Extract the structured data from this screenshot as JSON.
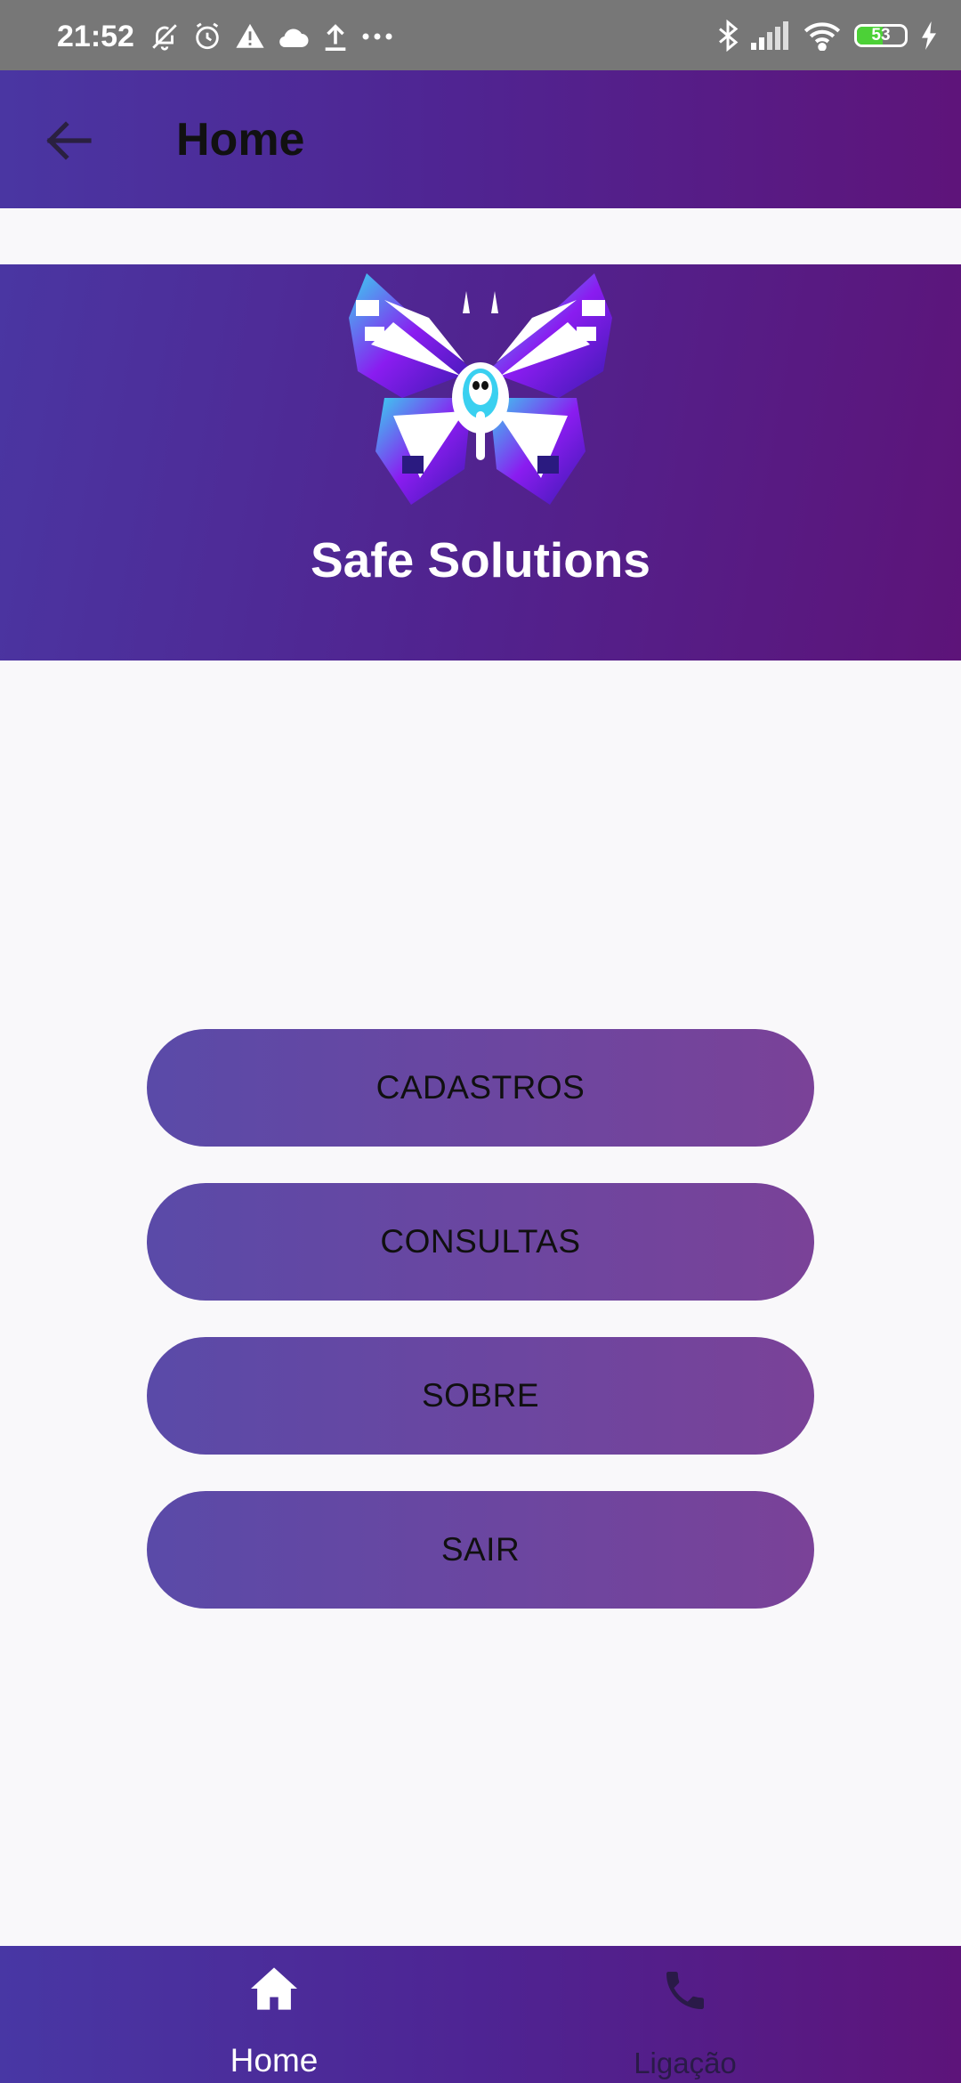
{
  "status_bar": {
    "time": "21:52",
    "battery": "53",
    "battery_level": 0.53,
    "icons_left": [
      "bell-off-icon",
      "alarm-icon",
      "warning-icon",
      "cloud-icon",
      "upload-icon",
      "more-dots-icon"
    ],
    "icons_right": [
      "bluetooth-icon",
      "signal-icon",
      "wifi-icon",
      "battery-icon",
      "charging-icon"
    ]
  },
  "app_bar": {
    "title": "Home",
    "back_icon": "arrow-back-icon"
  },
  "banner": {
    "logo": "butterfly-logo",
    "brand_name": "Safe Solutions"
  },
  "menu": {
    "buttons": [
      "CADASTROS",
      "CONSULTAS",
      "SOBRE",
      "SAIR"
    ]
  },
  "bottom_nav": {
    "items": [
      {
        "label": "Home",
        "icon": "home-icon",
        "active": true
      },
      {
        "label": "Ligação",
        "icon": "phone-icon",
        "active": false
      }
    ]
  },
  "colors": {
    "header_gradient_start": "#4a36a2",
    "header_gradient_end": "#5e147a",
    "button_gradient_start": "#5a4aa8",
    "button_gradient_end": "#7a4298",
    "background": "#f9f8fa",
    "status_bar": "#777777"
  }
}
